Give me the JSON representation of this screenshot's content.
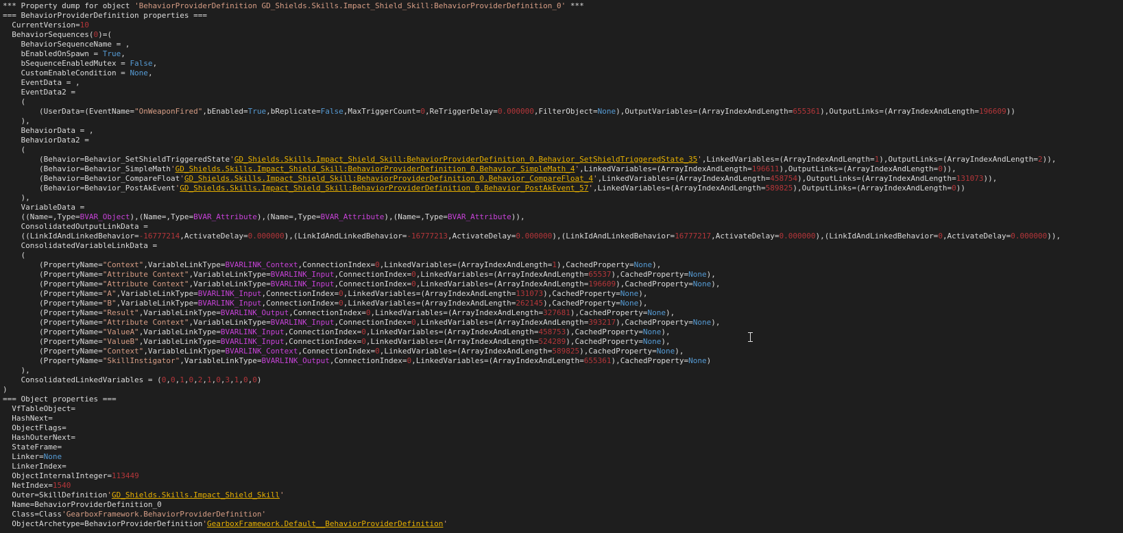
{
  "console": {
    "lines": [
      "*** Property dump for object {s:'BehaviorProviderDefinition GD_Shields.Skills.Impact_Shield_Skill:BehaviorProviderDefinition_0'} ***",
      "=== BehaviorProviderDefinition properties ===",
      "  CurrentVersion={n:10}",
      "  BehaviorSequences({n:0})=(",
      "    BehaviorSequenceName = ,",
      "    bEnabledOnSpawn = {k:True},",
      "    bSequenceEnabledMutex = {k:False},",
      "    CustomEnableCondition = {k:None},",
      "    EventData = ,",
      "    EventData2 =",
      "    (",
      "        (UserData=(EventName={s:\"OnWeaponFired\"},bEnabled={k:True},bReplicate={k:False},MaxTriggerCount={n:0},ReTriggerDelay={n:0.000000},FilterObject={k:None}),OutputVariables=(ArrayIndexAndLength={n:655361}),OutputLinks=(ArrayIndexAndLength={n:196609}))",
      "    ),",
      "    BehaviorData = ,",
      "    BehaviorData2 =",
      "    (",
      "        (Behavior=Behavior_SetShieldTriggeredState{s:'}{r:GD_Shields.Skills.Impact_Shield_Skill:BehaviorProviderDefinition_0.Behavior_SetShieldTriggeredState_35}{s:'},LinkedVariables=(ArrayIndexAndLength={n:1}),OutputLinks=(ArrayIndexAndLength={n:2})),",
      "        (Behavior=Behavior_SimpleMath{s:'}{r:GD_Shields.Skills.Impact_Shield_Skill:BehaviorProviderDefinition_0.Behavior_SimpleMath_4}{s:'},LinkedVariables=(ArrayIndexAndLength={n:196611}),OutputLinks=(ArrayIndexAndLength={n:0})),",
      "        (Behavior=Behavior_CompareFloat{s:'}{r:GD_Shields.Skills.Impact_Shield_Skill:BehaviorProviderDefinition_0.Behavior_CompareFloat_4}{s:'},LinkedVariables=(ArrayIndexAndLength={n:458754}),OutputLinks=(ArrayIndexAndLength={n:131073})),",
      "        (Behavior=Behavior_PostAkEvent{s:'}{r:GD_Shields.Skills.Impact_Shield_Skill:BehaviorProviderDefinition_0.Behavior_PostAkEvent_57}{s:'},LinkedVariables=(ArrayIndexAndLength={n:589825}),OutputLinks=(ArrayIndexAndLength={n:0}))",
      "    ),",
      "    VariableData =",
      "    ((Name=,Type={e:BVAR_Object}),(Name=,Type={e:BVAR_Attribute}),(Name=,Type={e:BVAR_Attribute}),(Name=,Type={e:BVAR_Attribute})),",
      "    ConsolidatedOutputLinkData =",
      "    ((LinkIdAndLinkedBehavior={n:-16777214},ActivateDelay={n:0.000000}),(LinkIdAndLinkedBehavior={n:-16777213},ActivateDelay={n:0.000000}),(LinkIdAndLinkedBehavior={n:16777217},ActivateDelay={n:0.000000}),(LinkIdAndLinkedBehavior={n:0},ActivateDelay={n:0.000000})),",
      "    ConsolidatedVariableLinkData =",
      "    (",
      "        (PropertyName={s:\"Context\"},VariableLinkType={e:BVARLINK_Context},ConnectionIndex={n:0},LinkedVariables=(ArrayIndexAndLength={n:1}),CachedProperty={k:None}),",
      "        (PropertyName={s:\"Attribute Context\"},VariableLinkType={e:BVARLINK_Input},ConnectionIndex={n:0},LinkedVariables=(ArrayIndexAndLength={n:65537}),CachedProperty={k:None}),",
      "        (PropertyName={s:\"Attribute Context\"},VariableLinkType={e:BVARLINK_Input},ConnectionIndex={n:0},LinkedVariables=(ArrayIndexAndLength={n:196609}),CachedProperty={k:None}),",
      "        (PropertyName={s:\"A\"},VariableLinkType={e:BVARLINK_Input},ConnectionIndex={n:0},LinkedVariables=(ArrayIndexAndLength={n:131073}),CachedProperty={k:None}),",
      "        (PropertyName={s:\"B\"},VariableLinkType={e:BVARLINK_Input},ConnectionIndex={n:0},LinkedVariables=(ArrayIndexAndLength={n:262145}),CachedProperty={k:None}),",
      "        (PropertyName={s:\"Result\"},VariableLinkType={e:BVARLINK_Output},ConnectionIndex={n:0},LinkedVariables=(ArrayIndexAndLength={n:327681}),CachedProperty={k:None}),",
      "        (PropertyName={s:\"Attribute Context\"},VariableLinkType={e:BVARLINK_Input},ConnectionIndex={n:0},LinkedVariables=(ArrayIndexAndLength={n:393217}),CachedProperty={k:None}),",
      "        (PropertyName={s:\"ValueA\"},VariableLinkType={e:BVARLINK_Input},ConnectionIndex={n:0},LinkedVariables=(ArrayIndexAndLength={n:458753}),CachedProperty={k:None}),",
      "        (PropertyName={s:\"ValueB\"},VariableLinkType={e:BVARLINK_Input},ConnectionIndex={n:0},LinkedVariables=(ArrayIndexAndLength={n:524289}),CachedProperty={k:None}),",
      "        (PropertyName={s:\"Context\"},VariableLinkType={e:BVARLINK_Context},ConnectionIndex={n:0},LinkedVariables=(ArrayIndexAndLength={n:589825}),CachedProperty={k:None}),",
      "        (PropertyName={s:\"SkillInstigator\"},VariableLinkType={e:BVARLINK_Output},ConnectionIndex={n:0},LinkedVariables=(ArrayIndexAndLength={n:655361}),CachedProperty={k:None})",
      "    ),",
      "    ConsolidatedLinkedVariables = ({n:0},{n:0},{n:1},{n:0},{n:2},{n:1},{n:0},{n:3},{n:1},{n:0},{n:0})",
      ")",
      "=== Object properties ===",
      "  VfTableObject=",
      "  HashNext=",
      "  ObjectFlags=",
      "  HashOuterNext=",
      "  StateFrame=",
      "  Linker={k:None}",
      "  LinkerIndex=",
      "  ObjectInternalInteger={n:113449}",
      "  NetIndex={n:1540}",
      "  Outer=SkillDefinition{s:'}{r:GD_Shields.Skills.Impact_Shield_Skill}{s:'}",
      "  Name=BehaviorProviderDefinition_0",
      "  Class=Class{s:'GearboxFramework.BehaviorProviderDefinition'}",
      "  ObjectArchetype=BehaviorProviderDefinition{s:'}{r:GearboxFramework.Default__BehaviorProviderDefinition}{s:'}"
    ]
  },
  "colors": {
    "background": "#1e1e1e",
    "text": "#dcdcdc",
    "string": "#d69d85",
    "number": "#b5363a",
    "keyword": "#569cd6",
    "enum": "#c742d8",
    "reference": "#e8b100"
  },
  "cursor_icon": "i-beam-cursor-icon"
}
